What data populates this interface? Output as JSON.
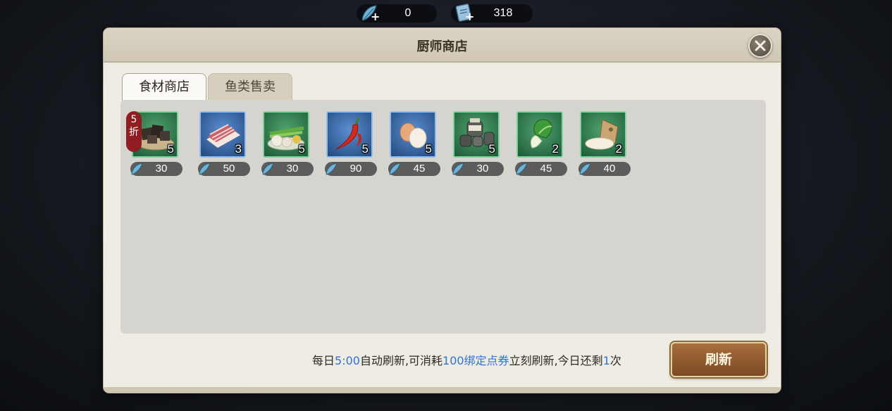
{
  "currencies": [
    {
      "icon": "feather-coin-icon",
      "value": "0"
    },
    {
      "icon": "scroll-ticket-icon",
      "value": "318"
    }
  ],
  "window": {
    "title": "厨师商店"
  },
  "tabs": [
    {
      "label": "食材商店",
      "active": true
    },
    {
      "label": "鱼类售卖",
      "active": false
    }
  ],
  "items": [
    {
      "name": "tofu-icon",
      "qty": "5",
      "price": "30",
      "frame": "green",
      "discount": "5折"
    },
    {
      "name": "pork-belly-icon",
      "qty": "3",
      "price": "50",
      "frame": "blue",
      "discount": ""
    },
    {
      "name": "scallion-garlic-icon",
      "qty": "5",
      "price": "30",
      "frame": "green",
      "discount": ""
    },
    {
      "name": "chili-pepper-icon",
      "qty": "5",
      "price": "90",
      "frame": "blue",
      "discount": ""
    },
    {
      "name": "eggs-icon",
      "qty": "5",
      "price": "45",
      "frame": "blue",
      "discount": ""
    },
    {
      "name": "condiment-jars-icon",
      "qty": "5",
      "price": "30",
      "frame": "green",
      "discount": ""
    },
    {
      "name": "bok-choy-icon",
      "qty": "2",
      "price": "45",
      "frame": "green",
      "discount": ""
    },
    {
      "name": "flour-sack-icon",
      "qty": "2",
      "price": "40",
      "frame": "green",
      "discount": ""
    }
  ],
  "footer": {
    "p1": "每日",
    "time": "5:00",
    "p2": "自动刷新,可消耗",
    "cost": "100绑定点券",
    "p3": "立刻刷新,今日还剩",
    "remaining": "1",
    "p4": "次"
  },
  "refresh_label": "刷新",
  "colors": {
    "highlight": "#2d74d6",
    "discount_badge": "#8f1d22",
    "green_frame": "#7fd39a",
    "blue_frame": "#8fbdf0"
  }
}
